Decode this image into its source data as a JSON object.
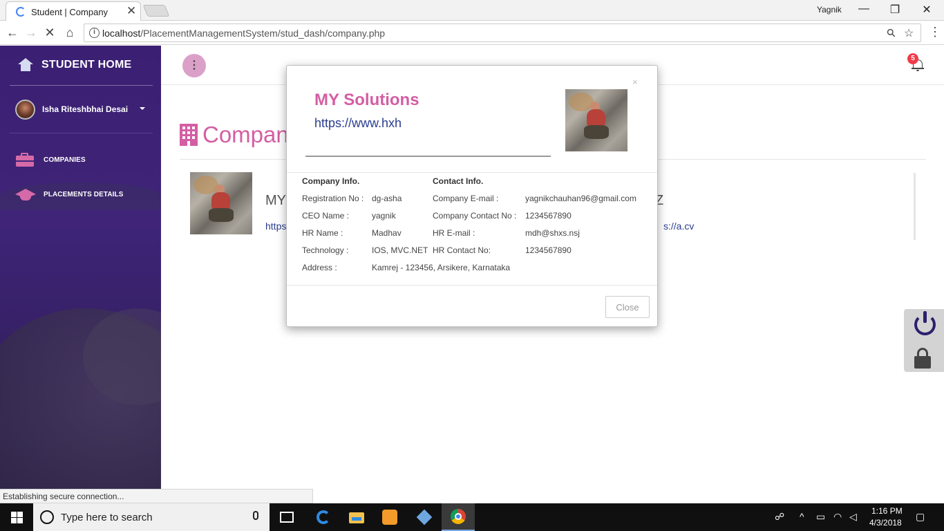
{
  "browser": {
    "tab_title": "Student | Company",
    "tab_close": "✕",
    "user_name": "Yagnik",
    "window_controls": {
      "minimize": "—",
      "restore": "❐",
      "close": "✕"
    },
    "url_host": "localhost",
    "url_path": "/PlacementManagementSystem/stud_dash/company.php",
    "nav": {
      "back": "←",
      "forward": "→",
      "reload": "✕",
      "home": "⌂"
    },
    "search_glyph": "⚲",
    "star_glyph": "☆",
    "menu_glyph": "⋮",
    "status_text": "Establishing secure connection..."
  },
  "sidebar": {
    "brand_label": "STUDENT HOME",
    "user_name": "Isha Riteshbhai Desai",
    "items": [
      {
        "label": "COMPANIES",
        "icon": "briefcase-icon"
      },
      {
        "label": "PLACEMENTS DETAILS",
        "icon": "graduation-cap-icon"
      }
    ]
  },
  "header": {
    "fab_glyph": "⋮",
    "notification_count": "5"
  },
  "main": {
    "page_title": "Compan",
    "card": {
      "name_visible_left": "MY",
      "link_visible_left": "https",
      "name_visible_right": "Z",
      "link_visible_right": "s://a.cv"
    }
  },
  "modal": {
    "close_x": "×",
    "title": "MY Solutions",
    "url": "https://www.hxh",
    "company_info": {
      "heading": "Company Info.",
      "rows": [
        {
          "label": "Registration No :",
          "value": "dg-asha"
        },
        {
          "label": "CEO Name :",
          "value": "yagnik"
        },
        {
          "label": "HR Name :",
          "value": "Madhav"
        },
        {
          "label": "Technology :",
          "value": "IOS, MVC.NET"
        },
        {
          "label": "Address :",
          "value": "Kamrej - 123456, Arsikere, Karnataka"
        }
      ]
    },
    "contact_info": {
      "heading": "Contact Info.",
      "rows": [
        {
          "label": "Company E-mail :",
          "value": "yagnikchauhan96@gmail.com"
        },
        {
          "label": "Company Contact No :",
          "value": "1234567890"
        },
        {
          "label": "HR E-mail :",
          "value": "mdh@shxs.nsj"
        },
        {
          "label": "HR Contact No:",
          "value": "1234567890"
        }
      ]
    },
    "close_button": "Close"
  },
  "taskbar": {
    "search_placeholder": "Type here to search",
    "time": "1:16 PM",
    "date": "4/3/2018"
  },
  "colors": {
    "accent_pink": "#d45ea3",
    "sidebar_purple": "#3f2478",
    "link_blue": "#2a3d8f",
    "badge_red": "#f03b4a"
  }
}
